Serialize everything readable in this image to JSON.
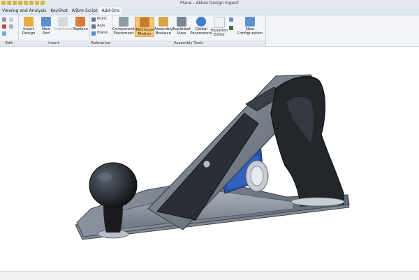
{
  "window": {
    "title": "Plane - Alibre Design Expert"
  },
  "menu": {
    "items": [
      "Viewing and Analysis",
      "KeyShot",
      "Alibre Script",
      "Add-Ons"
    ],
    "active_index": 3
  },
  "ribbon": {
    "groups": {
      "edit": {
        "label": "Edit"
      },
      "insert": {
        "label": "Insert",
        "insert_design": "Insert\nDesign",
        "new_part": "New\nPart",
        "duplicate": "Duplicate",
        "replace": "Replace"
      },
      "reference": {
        "label": "Reference",
        "point": "Point",
        "axis": "Axis",
        "plane": "Plane"
      },
      "assembly_tools": {
        "label": "Assembly Tools",
        "component_placement": "Component\nPlacement",
        "minimum_motion": "Minimum\nMotion",
        "assembly_boolean": "Assembly\nBoolean",
        "exploded_view": "Exploded\nView",
        "global_parameters": "Global\nParameters",
        "equation_editor": "Equation\nEditor",
        "new_configuration": "New\nConfiguration"
      }
    }
  },
  "colors": {
    "ribbon_bg": "#f2f4f8",
    "highlight": "#f5c57a",
    "blue_icon": "#3d7cc9",
    "plane_body": "#8e97a4",
    "handle": "#23262b",
    "blue_frog": "#2452a8"
  }
}
